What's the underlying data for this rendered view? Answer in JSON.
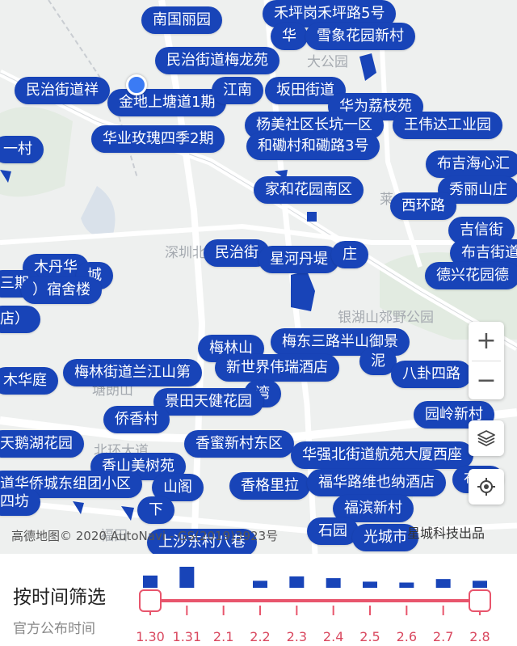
{
  "map": {
    "place_labels": [
      "大公园",
      "银湖山郊野公园",
      "深圳北",
      "北环大道",
      "塘朗山",
      "福田",
      "莱",
      "梅林"
    ],
    "tags": [
      "南国丽园",
      "禾坪岗禾坪路5号",
      "华",
      "雪象花园新村",
      "民治街道梅龙苑",
      "民治街道祥",
      "金地上塘道1期",
      "江南",
      "坂田街道",
      "华为荔枝苑",
      "杨美社区长坑一区",
      "和磡村和磡路3号",
      "华业玫瑰四季2期",
      "王伟达工业园",
      "一村",
      "布吉海心汇",
      "家和花园南区",
      "秀丽山庄",
      "西环路",
      "吉信街",
      "布吉街道",
      "民治街",
      "星河丹堤",
      "庄",
      "德兴花园德",
      "木丹华",
      "城",
      "三期",
      "）宿舍楼",
      "店）",
      "梅林山",
      "梅东三路半山御景",
      "泥",
      "八卦四路",
      "木华庭",
      "梅林街道兰江山第",
      "新世界伟瑞酒店",
      "湾",
      "景田天健花园",
      "园岭新村",
      "侨香村",
      "天鹅湖花园",
      "香蜜新村东区",
      "华强北街道航苑大厦西座",
      "香山美树苑",
      "道华侨城东组团小区",
      "山阁",
      "香格里拉",
      "福华路维也纳酒店",
      "福滨新村",
      "四坊",
      "下",
      "石园",
      "光城市",
      "上沙东村八巷",
      "布吉"
    ],
    "zoom_in": "+",
    "zoom_out": "−",
    "layers_icon": "layers-icon",
    "locate_icon": "locate-icon",
    "copyright": "高德地图© 2020 AutoNavi - GS(2019)3923号",
    "maker": "星城科技出品"
  },
  "filter": {
    "title": "按时间筛选",
    "subtitle": "官方公布时间",
    "dates": [
      "1.30",
      "1.31",
      "2.1",
      "2.2",
      "2.3",
      "2.4",
      "2.5",
      "2.6",
      "2.7",
      "2.8"
    ],
    "counts": [
      14,
      24,
      0,
      8,
      13,
      11,
      7,
      6,
      10,
      8
    ],
    "range_start": "1.30",
    "range_end": "2.8",
    "bar_color": "#1844b8",
    "track_color": "#e8556c"
  }
}
